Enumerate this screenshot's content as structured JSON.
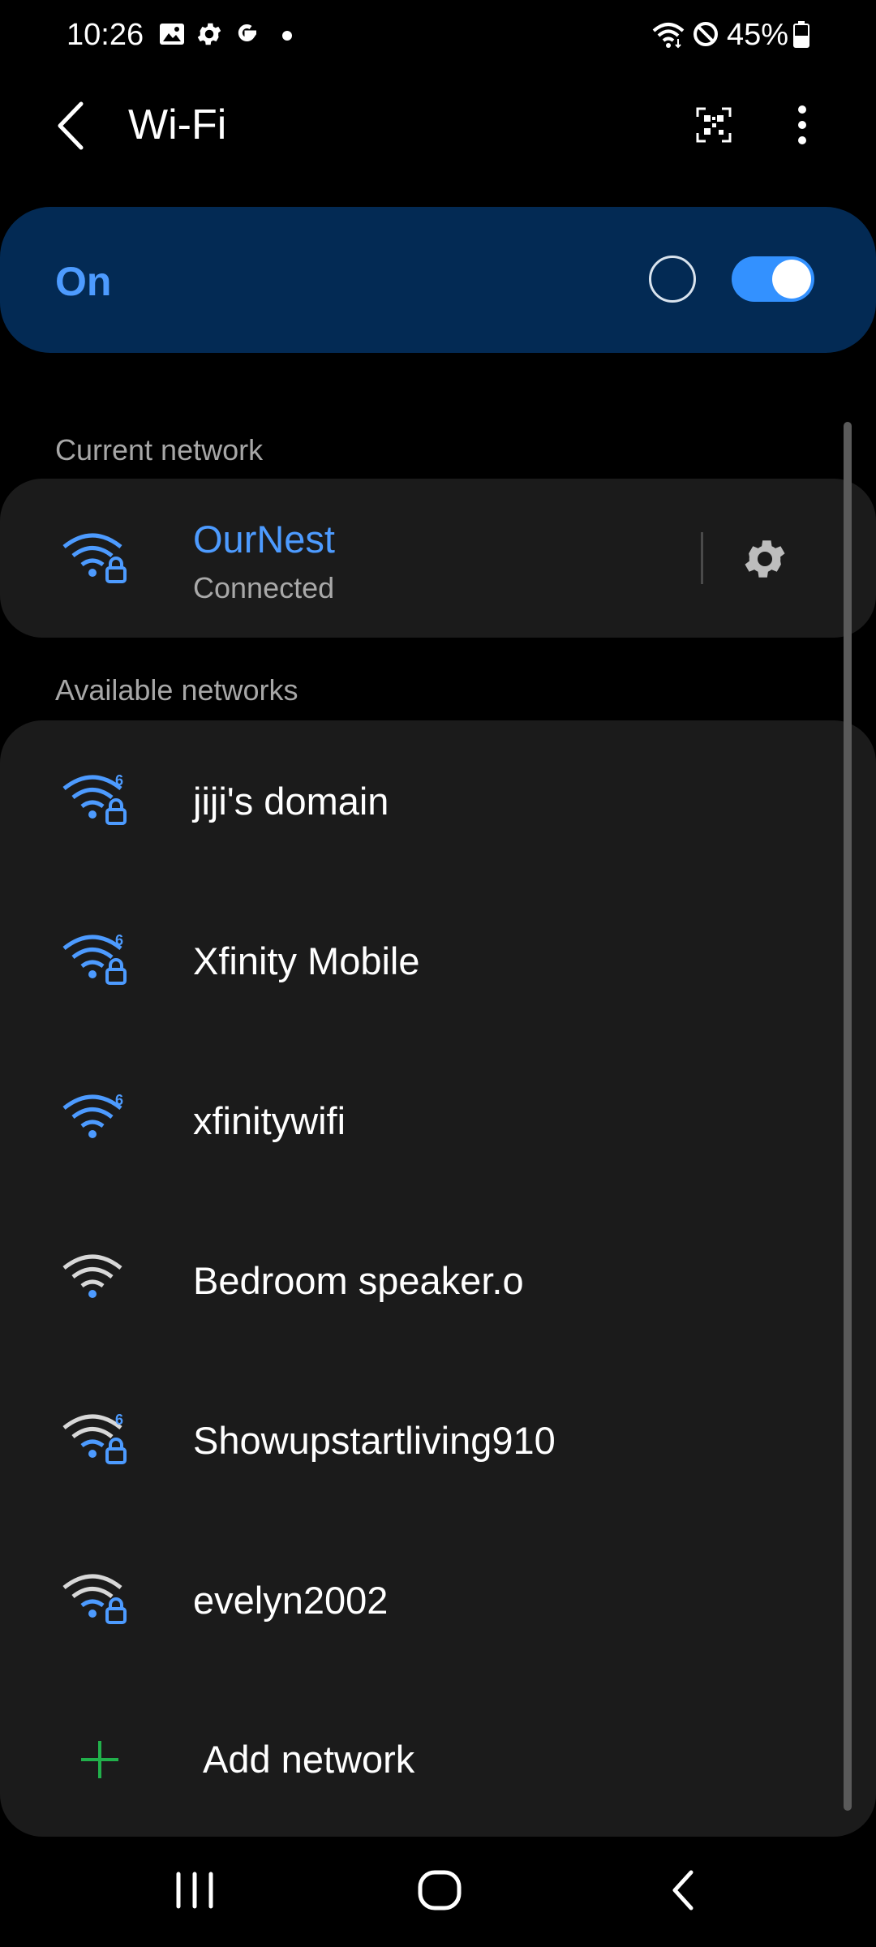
{
  "status_bar": {
    "time": "10:26",
    "battery": "45%",
    "icons": [
      "gallery-icon",
      "settings-gear-icon",
      "google-icon",
      "dot-icon",
      "wifi-status-icon",
      "do-not-disturb-icon",
      "battery-icon"
    ]
  },
  "header": {
    "title": "Wi-Fi",
    "back_icon": "back-arrow-icon",
    "qr_icon": "qr-scan-icon",
    "menu_icon": "more-options-icon"
  },
  "master": {
    "label": "On",
    "enabled": true,
    "accent": "#3391ff"
  },
  "current": {
    "section_label": "Current network",
    "name": "OurNest",
    "status": "Connected"
  },
  "available": {
    "section_label": "Available networks",
    "networks": [
      {
        "name": "jiji's domain",
        "color": "#4d9bff",
        "wifi6": true,
        "locked": true
      },
      {
        "name": "Xfinity Mobile",
        "color": "#4d9bff",
        "wifi6": true,
        "locked": true
      },
      {
        "name": "xfinitywifi",
        "color": "#4d9bff",
        "wifi6": true,
        "locked": false
      },
      {
        "name": "Bedroom speaker.o",
        "color": "#d8d8d8",
        "wifi6": false,
        "locked": false
      },
      {
        "name": "Showupstartliving910",
        "color": "#d8d8d8",
        "wifi6": true,
        "locked": true
      },
      {
        "name": "evelyn2002",
        "color": "#d8d8d8",
        "wifi6": false,
        "locked": true
      }
    ],
    "add_label": "Add network"
  },
  "navbar": {
    "icons": [
      "recent-apps-icon",
      "home-icon",
      "back-icon"
    ]
  }
}
